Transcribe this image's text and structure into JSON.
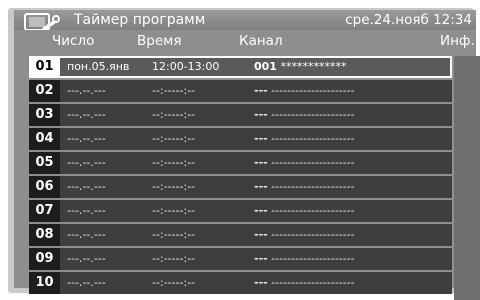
{
  "title": "Таймер программ",
  "datetime": "сре.24.нояб 12:34",
  "headers": {
    "number": "Число",
    "time": "Время",
    "channel": "Канал",
    "info": "Инф."
  },
  "rows": [
    {
      "n": "01",
      "date": "пон.05.янв",
      "time": "12:00-13:00",
      "channel_num": "001",
      "channel_name": "************"
    },
    {
      "n": "02",
      "date": "---.--.---",
      "time": "--:-----:--",
      "channel_num": "---",
      "channel_name": "---------------------"
    },
    {
      "n": "03",
      "date": "---.--.---",
      "time": "--:-----:--",
      "channel_num": "---",
      "channel_name": "---------------------"
    },
    {
      "n": "04",
      "date": "---.--.---",
      "time": "--:-----:--",
      "channel_num": "---",
      "channel_name": "---------------------"
    },
    {
      "n": "05",
      "date": "---.--.---",
      "time": "--:-----:--",
      "channel_num": "---",
      "channel_name": "---------------------"
    },
    {
      "n": "06",
      "date": "---.--.---",
      "time": "--:-----:--",
      "channel_num": "---",
      "channel_name": "---------------------"
    },
    {
      "n": "07",
      "date": "---.--.---",
      "time": "--:-----:--",
      "channel_num": "---",
      "channel_name": "---------------------"
    },
    {
      "n": "08",
      "date": "---.--.---",
      "time": "--:-----:--",
      "channel_num": "---",
      "channel_name": "---------------------"
    },
    {
      "n": "09",
      "date": "---.--.---",
      "time": "--:-----:--",
      "channel_num": "---",
      "channel_name": "---------------------"
    },
    {
      "n": "10",
      "date": "---.--.---",
      "time": "--:-----:--",
      "channel_num": "---",
      "channel_name": "---------------------"
    }
  ],
  "icons": {
    "title_icon": "tv-tools-icon"
  },
  "colors": {
    "selected_border": "#ffffff",
    "row_bg": "#3e3e3e",
    "number_bg": "#1d1d1d"
  }
}
